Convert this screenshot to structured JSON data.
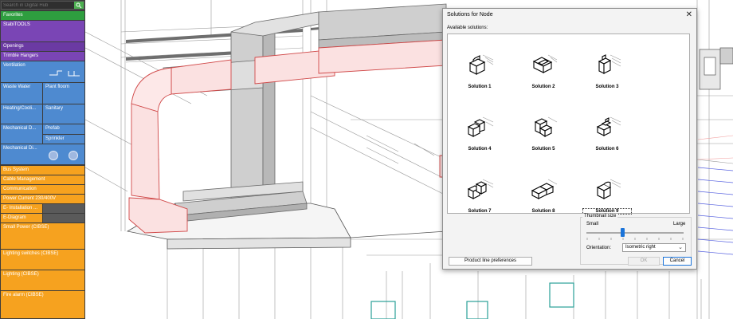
{
  "palette": {
    "search_placeholder": "Search in Digital Hub",
    "favorites": "Favorites",
    "stabitools": "StabiTOOLS",
    "openings": "Openings",
    "trimble_hangers": "Trimble Hangers",
    "ventilation": "Ventilation",
    "waste_water": "Waste Water",
    "plant_floom": "Plant floom",
    "heating_cooling": "Heating/Cooli...",
    "sanitary": "Sanitary",
    "mechanical_d1": "Mechanical D...",
    "prefab": "Prefab",
    "sprinkler": "Sprinkler",
    "mechanical_d2": "Mechanical Di...",
    "bus_system": "Bus System",
    "cable_management": "Cable Management",
    "communication": "Communication",
    "power_current": "Power Current 230/400V",
    "e_installation": "E- Installation ...",
    "e_diagram": "E-Diagram",
    "small_power": "Small Power (CIBSE)",
    "lighting_switches": "Lighting switches (CIBSE)",
    "lighting": "Lighting (CIBSE)",
    "fire_alarm": "Fire alarm (CIBSE)"
  },
  "dialog": {
    "title": "Solutions for Node",
    "close": "✕",
    "available_label": "Available solutions:",
    "solutions": [
      "Solution 1",
      "Solution 2",
      "Solution 3",
      "Solution 4",
      "Solution 5",
      "Solution 6",
      "Solution 7",
      "Solution 8",
      "Solution 9"
    ],
    "selected_solution": "Solution 9",
    "thumbnail_size_label": "Thumbnail size",
    "small_label": "Small",
    "large_label": "Large",
    "thumbnail_size": 0.37,
    "orientation_label": "Orientation:",
    "orientation_value": "Isometric right",
    "product_line_button": "Product line preferences",
    "ok_button": "OK",
    "cancel_button": "Cancel"
  },
  "colors": {
    "accent": "#1a73d9",
    "duct_red": "#e06666",
    "duct_gray": "#c8c8c8",
    "favorites_green": "#2e9e3f",
    "stabitools_purple": "#7a45b5",
    "ventilation_blue": "#4e8ad0",
    "electrical_orange": "#f6a21f"
  }
}
